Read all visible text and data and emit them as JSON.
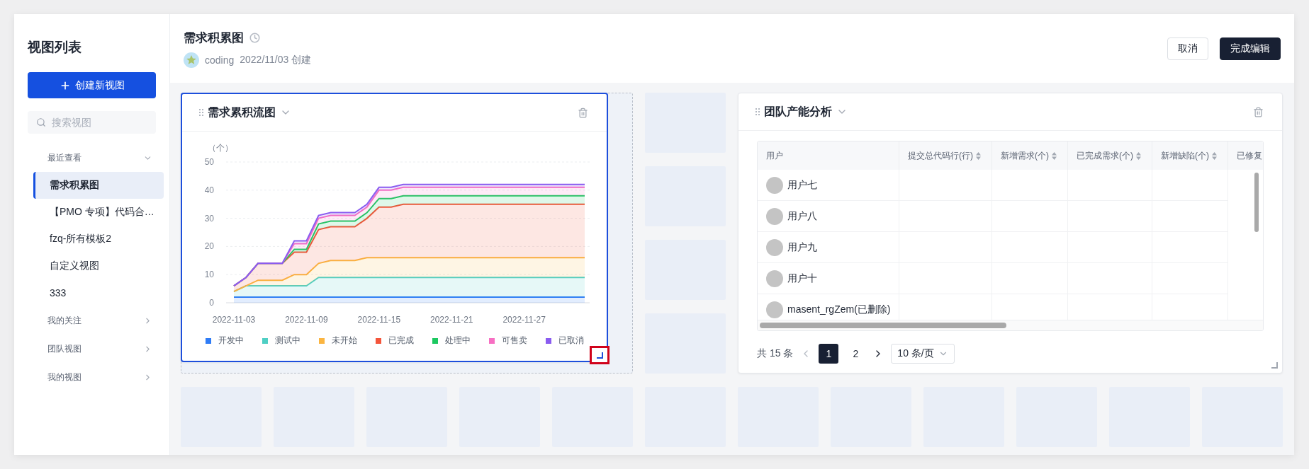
{
  "sidebar": {
    "title": "视图列表",
    "create_button": "创建新视图",
    "search": {
      "placeholder": "搜索视图"
    },
    "sections": [
      {
        "label": "最近查看",
        "expanded": true,
        "items": [
          {
            "label": "需求积累图",
            "selected": true
          },
          {
            "label": "【PMO 专项】代码合…",
            "selected": false
          },
          {
            "label": "fzq-所有模板2",
            "selected": false
          },
          {
            "label": "自定义视图",
            "selected": false
          },
          {
            "label": "333",
            "selected": false
          }
        ]
      },
      {
        "label": "我的关注",
        "expanded": false
      },
      {
        "label": "团队视图",
        "expanded": false
      },
      {
        "label": "我的视图",
        "expanded": false
      }
    ]
  },
  "header": {
    "title": "需求积累图",
    "author": "coding",
    "created": "2022/11/03 创建",
    "buttons": [
      {
        "label": "取消",
        "kind": "secondary"
      },
      {
        "label": "完成编辑",
        "kind": "primary"
      }
    ]
  },
  "widgets": [
    {
      "kind": "chart",
      "title": "需求累积流图",
      "selected": true,
      "chart_data": {
        "type": "area",
        "stacked": true,
        "ylabel": "（个）",
        "ylim": [
          0,
          50
        ],
        "yticks": [
          0,
          10,
          20,
          30,
          40,
          50
        ],
        "grid": true,
        "categories": [
          "2022-11-03",
          null,
          null,
          null,
          null,
          null,
          "2022-11-09",
          null,
          null,
          null,
          null,
          null,
          "2022-11-15",
          null,
          null,
          null,
          null,
          null,
          "2022-11-21",
          null,
          null,
          null,
          null,
          null,
          "2022-11-27",
          null,
          null,
          null,
          null,
          null
        ],
        "series": [
          {
            "name": "开发中",
            "color": "#2f7cf6",
            "values": [
              2,
              2,
              2,
              2,
              2,
              2,
              2,
              2,
              2,
              2,
              2,
              2,
              2,
              2,
              2,
              2,
              2,
              2,
              2,
              2,
              2,
              2,
              2,
              2,
              2,
              2,
              2,
              2,
              2,
              2
            ]
          },
          {
            "name": "测试中",
            "color": "#4fcfc4",
            "values": [
              2,
              4,
              4,
              4,
              4,
              4,
              4,
              7,
              7,
              7,
              7,
              7,
              7,
              7,
              7,
              7,
              7,
              7,
              7,
              7,
              7,
              7,
              7,
              7,
              7,
              7,
              7,
              7,
              7,
              7
            ]
          },
          {
            "name": "未开始",
            "color": "#fbb541",
            "values": [
              0,
              0,
              2,
              2,
              2,
              4,
              4,
              5,
              6,
              6,
              6,
              7,
              7,
              7,
              7,
              7,
              7,
              7,
              7,
              7,
              7,
              7,
              7,
              7,
              7,
              7,
              7,
              7,
              7,
              7
            ]
          },
          {
            "name": "已完成",
            "color": "#f4553b",
            "values": [
              2,
              3,
              6,
              6,
              6,
              8,
              8,
              12,
              12,
              12,
              12,
              14,
              18,
              18,
              19,
              19,
              19,
              19,
              19,
              19,
              19,
              19,
              19,
              19,
              19,
              19,
              19,
              19,
              19,
              19
            ]
          },
          {
            "name": "处理中",
            "color": "#1cc860",
            "values": [
              0,
              0,
              0,
              0,
              0,
              1,
              1,
              2,
              2,
              2,
              2,
              2,
              3,
              3,
              3,
              3,
              3,
              3,
              3,
              3,
              3,
              3,
              3,
              3,
              3,
              3,
              3,
              3,
              3,
              3
            ]
          },
          {
            "name": "可售卖",
            "color": "#f76fc3",
            "values": [
              0,
              0,
              0,
              0,
              0,
              2,
              2,
              2,
              2,
              2,
              2,
              2,
              3,
              3,
              3,
              3,
              3,
              3,
              3,
              3,
              3,
              3,
              3,
              3,
              3,
              3,
              3,
              3,
              3,
              3
            ]
          },
          {
            "name": "已取消",
            "color": "#8a5cf0",
            "values": [
              0,
              0,
              0,
              0,
              0,
              1,
              1,
              1,
              1,
              1,
              1,
              1,
              1,
              1,
              1,
              1,
              1,
              1,
              1,
              1,
              1,
              1,
              1,
              1,
              1,
              1,
              1,
              1,
              1,
              1
            ]
          }
        ]
      }
    },
    {
      "kind": "table",
      "title": "团队产能分析",
      "selected": false,
      "columns": [
        {
          "label": "用户",
          "sortable": false
        },
        {
          "label": "提交总代码行(行)",
          "sortable": true
        },
        {
          "label": "新增需求(个)",
          "sortable": true
        },
        {
          "label": "已完成需求(个)",
          "sortable": true
        },
        {
          "label": "新增缺陷(个)",
          "sortable": true
        },
        {
          "label": "已修复",
          "sortable": false
        }
      ],
      "rows": [
        {
          "user": "用户七"
        },
        {
          "user": "用户八"
        },
        {
          "user": "用户九"
        },
        {
          "user": "用户十"
        },
        {
          "user": "masent_rgZem(已删除)"
        }
      ],
      "pagination": {
        "total": "共 15 条",
        "pages": [
          {
            "label": "1",
            "selected": true
          },
          {
            "label": "2",
            "selected": false
          }
        ],
        "page_size": "10 条/页"
      }
    }
  ]
}
